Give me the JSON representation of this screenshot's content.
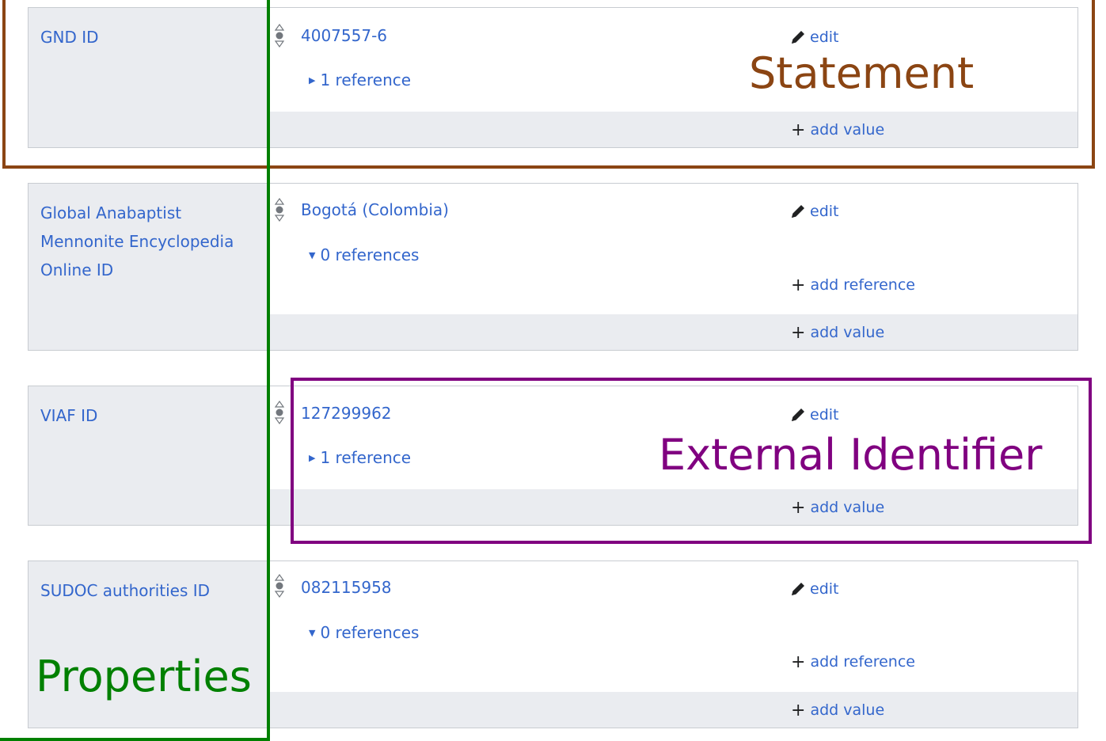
{
  "statements": [
    {
      "property": "GND ID",
      "value": "4007557-6",
      "references": "1 reference",
      "refs_expanded": false,
      "edit": "edit",
      "add_value": "add value"
    },
    {
      "property": "Global Anabaptist Mennonite Encyclopedia Online ID",
      "value": "Bogotá (Colombia)",
      "references": "0 references",
      "refs_expanded": true,
      "add_reference": "add reference",
      "edit": "edit",
      "add_value": "add value"
    },
    {
      "property": "VIAF ID",
      "value": "127299962",
      "references": "1 reference",
      "refs_expanded": false,
      "edit": "edit",
      "add_value": "add value"
    },
    {
      "property": "SUDOC authorities ID",
      "value": "082115958",
      "references": "0 references",
      "refs_expanded": true,
      "add_reference": "add reference",
      "edit": "edit",
      "add_value": "add value"
    }
  ],
  "annotations": {
    "statement": "Statement",
    "external_identifier": "External Identifier",
    "properties": "Properties"
  },
  "colors": {
    "link": "#3366cc",
    "statement_box": "#8b4513",
    "external_identifier_box": "#800080",
    "properties_box": "#008000",
    "panel_gray": "#eaecf0",
    "border": "#c8ccd1"
  },
  "icons": {
    "edit": "pencil-icon",
    "rank": "rank-selector-icon",
    "add": "plus-icon",
    "collapsed": "triangle-right-icon",
    "expanded": "triangle-down-icon"
  }
}
